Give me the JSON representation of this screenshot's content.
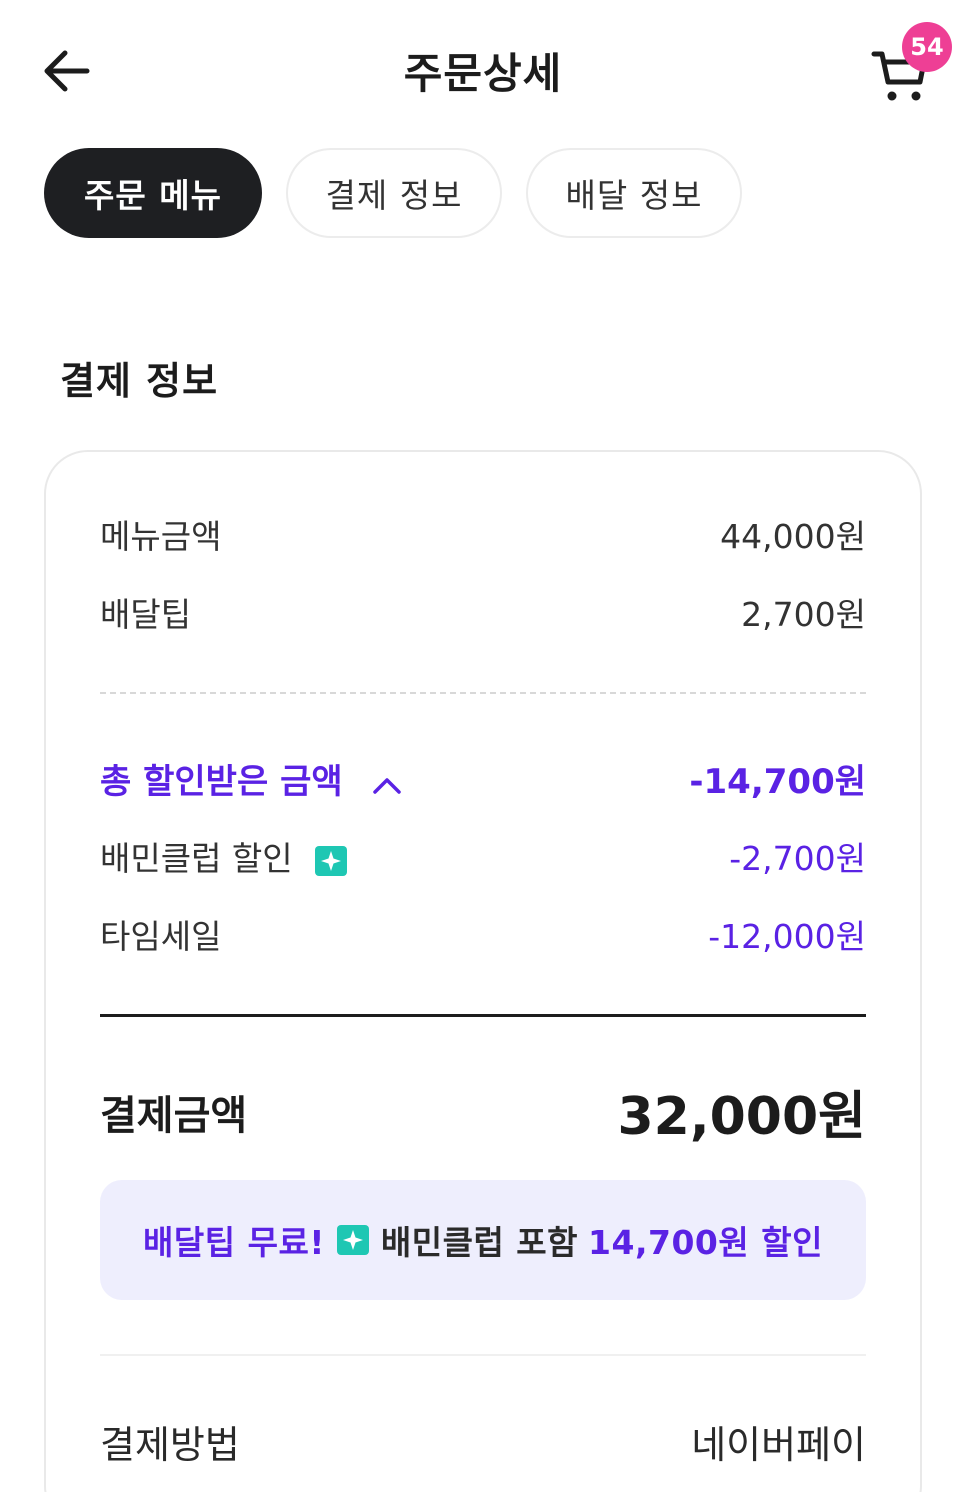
{
  "header": {
    "title": "주문상세",
    "cart_count": "54"
  },
  "tabs": [
    {
      "label": "주문 메뉴",
      "active": true
    },
    {
      "label": "결제 정보",
      "active": false
    },
    {
      "label": "배달 정보",
      "active": false
    }
  ],
  "section": {
    "title": "결제 정보"
  },
  "payment": {
    "menu_amount_label": "메뉴금액",
    "menu_amount_value": "44,000원",
    "delivery_tip_label": "배달팁",
    "delivery_tip_value": "2,700원",
    "discount_total_label": "총 할인받은 금액",
    "discount_total_value": "-14,700원",
    "baemin_club_label": "배민클럽 할인",
    "baemin_club_value": "-2,700원",
    "time_sale_label": "타임세일",
    "time_sale_value": "-12,000원",
    "total_label": "결제금액",
    "total_value": "32,000원",
    "promo_part1": "배달팁 무료!",
    "promo_part2": "배민클럽 포함",
    "promo_part3": "14,700원 할인",
    "method_label": "결제방법",
    "method_value": "네이버페이"
  },
  "colors": {
    "accent_purple": "#5a22e4",
    "badge_pink": "#ee3f95",
    "club_teal": "#1ec7b3"
  },
  "icons": {
    "back": "arrow-left-icon",
    "cart": "cart-icon",
    "chevron": "chevron-up-icon",
    "club": "baemin-club-icon"
  }
}
